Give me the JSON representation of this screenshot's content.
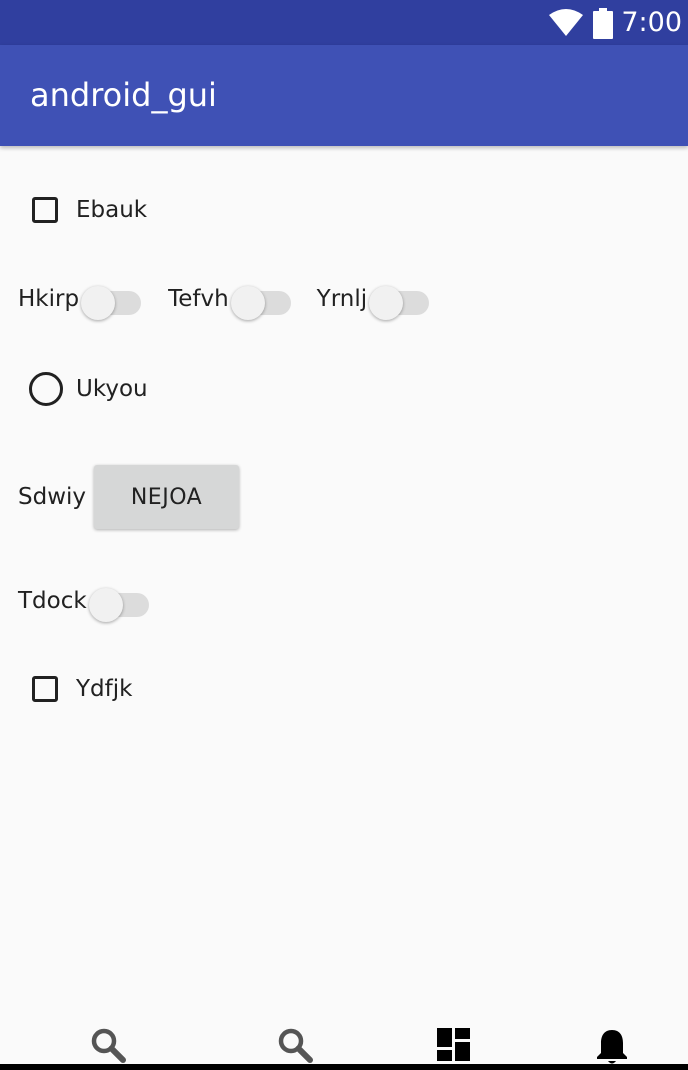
{
  "status_bar": {
    "time": "7:00",
    "icons": [
      "wifi-icon",
      "battery-icon"
    ],
    "background": "#303f9f"
  },
  "app_bar": {
    "title": "android_gui",
    "background": "#3f51b5"
  },
  "content": {
    "checkbox_1": {
      "label": "Ebauk",
      "checked": false
    },
    "switches_row": [
      {
        "label": "Hkirp",
        "on": false
      },
      {
        "label": "Tefvh",
        "on": false
      },
      {
        "label": "Yrnlj",
        "on": false
      }
    ],
    "radio_1": {
      "label": "Ukyou",
      "selected": false
    },
    "button_row": {
      "label": "Sdwiy",
      "button_label": "NEJOA"
    },
    "switch_single": {
      "label": "Tdock",
      "on": false
    },
    "checkbox_2": {
      "label": "Ydfjk",
      "checked": false
    }
  },
  "bottom_nav": {
    "items": [
      {
        "icon": "search-icon"
      },
      {
        "icon": "search-icon"
      },
      {
        "icon": "dashboard-icon"
      },
      {
        "icon": "bell-icon"
      }
    ]
  }
}
